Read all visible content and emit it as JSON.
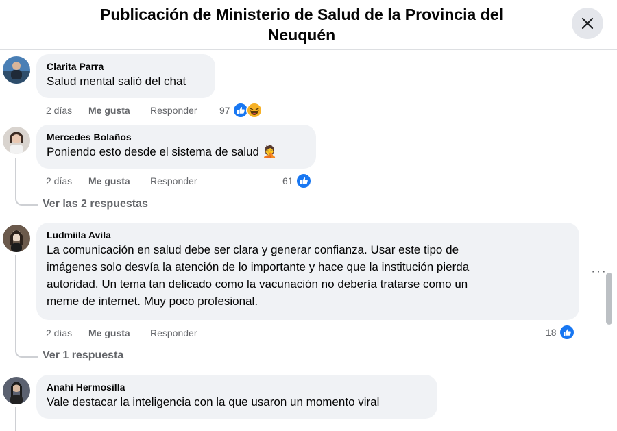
{
  "header": {
    "title_line1": "Publicación de Ministerio de Salud de la Provincia del",
    "title_line2": "Neuquén"
  },
  "comments": [
    {
      "author": "Clarita Parra",
      "text": "Salud mental salió del chat",
      "time": "2 días",
      "like": "Me gusta",
      "reply": "Responder",
      "reaction_count": "97",
      "reactions": [
        "like-icon",
        "haha-icon"
      ]
    },
    {
      "author": "Mercedes Bolaños",
      "text": "Poniendo esto desde el sistema de salud 🤦",
      "time": "2 días",
      "like": "Me gusta",
      "reply": "Responder",
      "reaction_count": "61",
      "reactions": [
        "like-icon"
      ],
      "replies": "Ver las 2 respuestas"
    },
    {
      "author": "Ludmiila Avila",
      "text_lines": [
        "La comunicación en salud debe ser clara y generar confianza. Usar este tipo de",
        "imágenes solo desvía la atención de lo importante y hace que la institución pierda",
        "autoridad. Un tema tan delicado como la vacunación no debería tratarse como un",
        "meme de internet. Muy poco profesional."
      ],
      "time": "2 días",
      "like": "Me gusta",
      "reply": "Responder",
      "reaction_count": "18",
      "reactions": [
        "like-icon"
      ],
      "replies": "Ver 1 respuesta"
    },
    {
      "author": "Anahi Hermosilla",
      "text": "Vale destacar la inteligencia con la que usaron un momento viral"
    }
  ],
  "colors": {
    "like_blue": "#1877f2",
    "bubble_bg": "#f0f2f5",
    "secondary_text": "#65676b"
  }
}
